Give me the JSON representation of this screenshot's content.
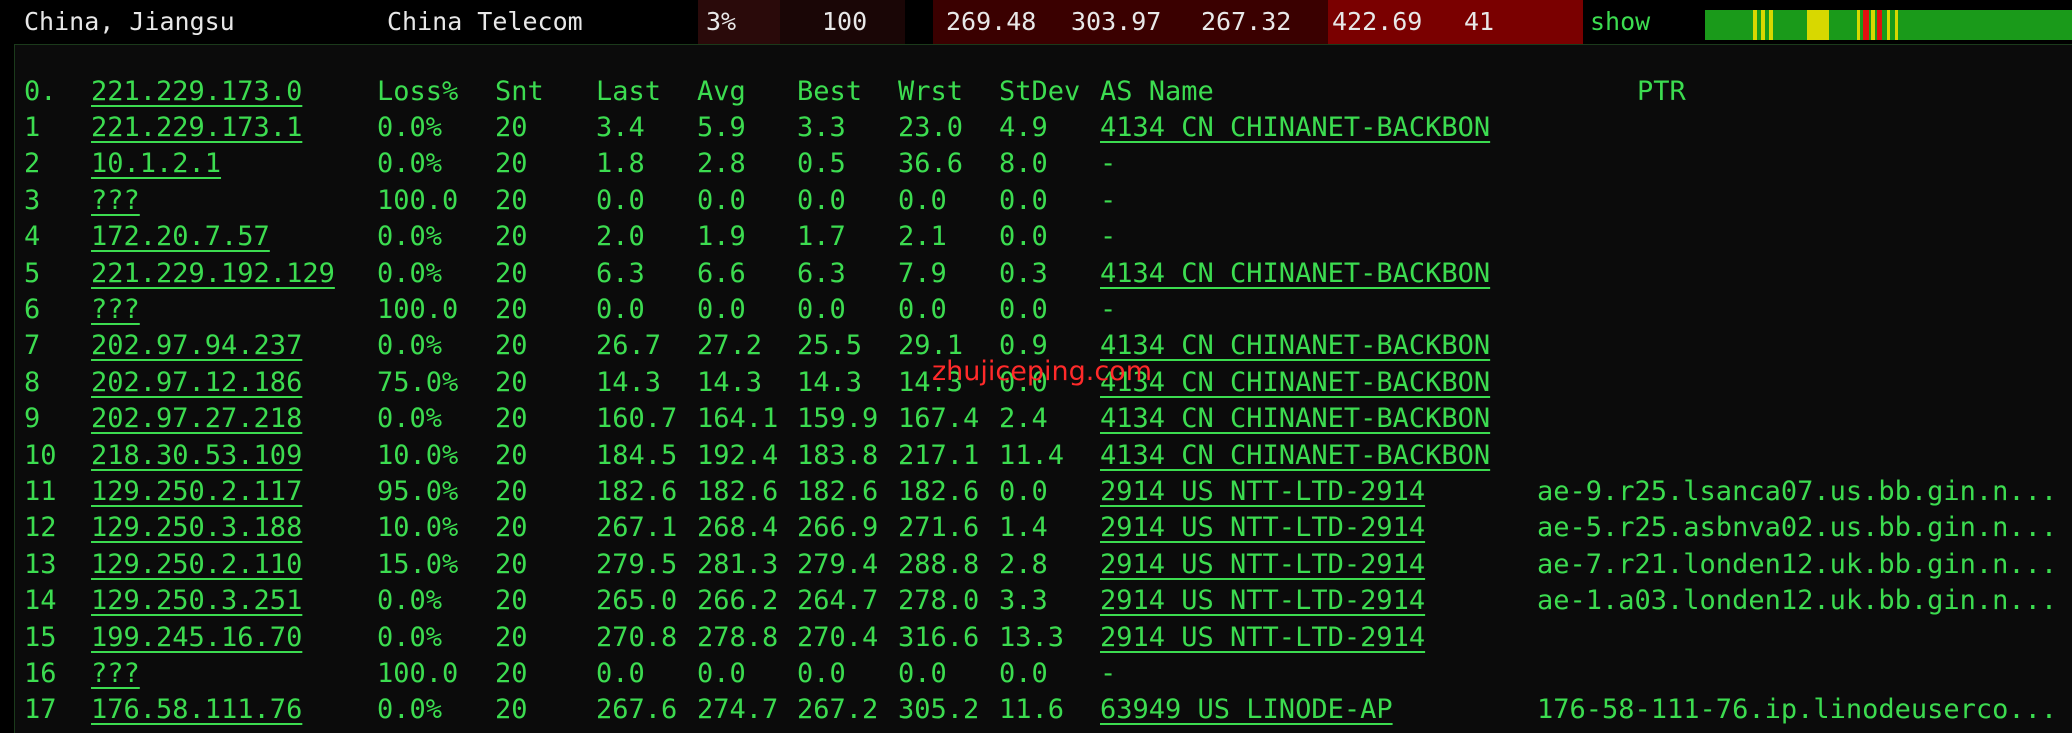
{
  "header": {
    "location": "China, Jiangsu",
    "isp": "China Telecom",
    "loss": "3%",
    "sent": "100",
    "avg": "269.48",
    "worst": "303.97",
    "best": "267.32",
    "max": "422.69",
    "stdev": "41",
    "show_label": "show"
  },
  "table": {
    "columns": {
      "hop": "0.",
      "host": "221.229.173.0",
      "loss": "Loss%",
      "snt": "Snt",
      "last": "Last",
      "avg": "Avg",
      "best": "Best",
      "wrst": "Wrst",
      "stdev": "StDev",
      "asname": "AS Name",
      "ptr": "PTR"
    },
    "rows": [
      {
        "hop": "1",
        "host": "221.229.173.1",
        "loss": "0.0%",
        "snt": "20",
        "last": "3.4",
        "avg": "5.9",
        "best": "3.3",
        "wrst": "23.0",
        "stdev": "4.9",
        "as": "4134  CN CHINANET-BACKBON",
        "ptr": ""
      },
      {
        "hop": "2",
        "host": "10.1.2.1",
        "loss": "0.0%",
        "snt": "20",
        "last": "1.8",
        "avg": "2.8",
        "best": "0.5",
        "wrst": "36.6",
        "stdev": "8.0",
        "as": "-",
        "ptr": ""
      },
      {
        "hop": "3",
        "host": "???",
        "loss": "100.0",
        "snt": "20",
        "last": "0.0",
        "avg": "0.0",
        "best": "0.0",
        "wrst": "0.0",
        "stdev": "0.0",
        "as": "-",
        "ptr": ""
      },
      {
        "hop": "4",
        "host": "172.20.7.57",
        "loss": "0.0%",
        "snt": "20",
        "last": "2.0",
        "avg": "1.9",
        "best": "1.7",
        "wrst": "2.1",
        "stdev": "0.0",
        "as": "-",
        "ptr": ""
      },
      {
        "hop": "5",
        "host": "221.229.192.129",
        "loss": "0.0%",
        "snt": "20",
        "last": "6.3",
        "avg": "6.6",
        "best": "6.3",
        "wrst": "7.9",
        "stdev": "0.3",
        "as": "4134  CN CHINANET-BACKBON",
        "ptr": ""
      },
      {
        "hop": "6",
        "host": "???",
        "loss": "100.0",
        "snt": "20",
        "last": "0.0",
        "avg": "0.0",
        "best": "0.0",
        "wrst": "0.0",
        "stdev": "0.0",
        "as": "-",
        "ptr": ""
      },
      {
        "hop": "7",
        "host": "202.97.94.237",
        "loss": "0.0%",
        "snt": "20",
        "last": "26.7",
        "avg": "27.2",
        "best": "25.5",
        "wrst": "29.1",
        "stdev": "0.9",
        "as": "4134  CN CHINANET-BACKBON",
        "ptr": ""
      },
      {
        "hop": "8",
        "host": "202.97.12.186",
        "loss": "75.0%",
        "snt": "20",
        "last": "14.3",
        "avg": "14.3",
        "best": "14.3",
        "wrst": "14.3",
        "stdev": "0.0",
        "as": "4134  CN CHINANET-BACKBON",
        "ptr": ""
      },
      {
        "hop": "9",
        "host": "202.97.27.218",
        "loss": "0.0%",
        "snt": "20",
        "last": "160.7",
        "avg": "164.1",
        "best": "159.9",
        "wrst": "167.4",
        "stdev": "2.4",
        "as": "4134  CN CHINANET-BACKBON",
        "ptr": ""
      },
      {
        "hop": "10",
        "host": "218.30.53.109",
        "loss": "10.0%",
        "snt": "20",
        "last": "184.5",
        "avg": "192.4",
        "best": "183.8",
        "wrst": "217.1",
        "stdev": "11.4",
        "as": "4134  CN CHINANET-BACKBON",
        "ptr": ""
      },
      {
        "hop": "11",
        "host": "129.250.2.117",
        "loss": "95.0%",
        "snt": "20",
        "last": "182.6",
        "avg": "182.6",
        "best": "182.6",
        "wrst": "182.6",
        "stdev": "0.0",
        "as": "2914  US NTT-LTD-2914",
        "ptr": "ae-9.r25.lsanca07.us.bb.gin.n..."
      },
      {
        "hop": "12",
        "host": "129.250.3.188",
        "loss": "10.0%",
        "snt": "20",
        "last": "267.1",
        "avg": "268.4",
        "best": "266.9",
        "wrst": "271.6",
        "stdev": "1.4",
        "as": "2914  US NTT-LTD-2914",
        "ptr": "ae-5.r25.asbnva02.us.bb.gin.n..."
      },
      {
        "hop": "13",
        "host": "129.250.2.110",
        "loss": "15.0%",
        "snt": "20",
        "last": "279.5",
        "avg": "281.3",
        "best": "279.4",
        "wrst": "288.8",
        "stdev": "2.8",
        "as": "2914  US NTT-LTD-2914",
        "ptr": "ae-7.r21.londen12.uk.bb.gin.n..."
      },
      {
        "hop": "14",
        "host": "129.250.3.251",
        "loss": "0.0%",
        "snt": "20",
        "last": "265.0",
        "avg": "266.2",
        "best": "264.7",
        "wrst": "278.0",
        "stdev": "3.3",
        "as": "2914  US NTT-LTD-2914",
        "ptr": "ae-1.a03.londen12.uk.bb.gin.n..."
      },
      {
        "hop": "15",
        "host": "199.245.16.70",
        "loss": "0.0%",
        "snt": "20",
        "last": "270.8",
        "avg": "278.8",
        "best": "270.4",
        "wrst": "316.6",
        "stdev": "13.3",
        "as": "2914  US NTT-LTD-2914",
        "ptr": ""
      },
      {
        "hop": "16",
        "host": "???",
        "loss": "100.0",
        "snt": "20",
        "last": "0.0",
        "avg": "0.0",
        "best": "0.0",
        "wrst": "0.0",
        "stdev": "0.0",
        "as": "-",
        "ptr": ""
      },
      {
        "hop": "17",
        "host": "176.58.111.76",
        "loss": "0.0%",
        "snt": "20",
        "last": "267.6",
        "avg": "274.7",
        "best": "267.2",
        "wrst": "305.2",
        "stdev": "11.6",
        "as": "63949 US LINODE-AP",
        "ptr": "176-58-111-76.ip.linodeuserco..."
      }
    ]
  },
  "watermark": "zhujiceping.com",
  "colors": {
    "terminal_green": "#3cdc50",
    "header_text": "#e8e8e8",
    "cell_dark": "#1e0808",
    "cell_red": "#7a0000",
    "graph_green": "#1a9a1a",
    "graph_yellow": "#d8d800",
    "graph_red": "#e01010"
  }
}
